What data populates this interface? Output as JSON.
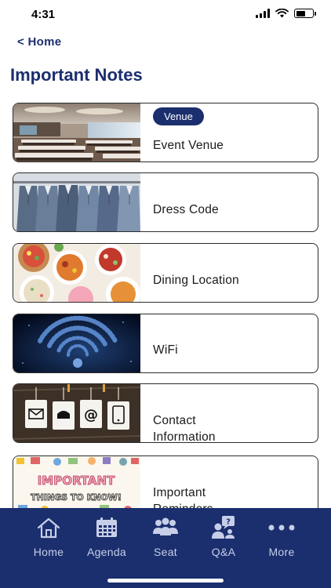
{
  "status": {
    "time": "4:31",
    "signal_icon": "cellular-signal-icon",
    "wifi_icon": "wifi-icon",
    "battery_icon": "battery-icon"
  },
  "nav": {
    "back_label": "< Home"
  },
  "page": {
    "title": "Important Notes"
  },
  "cards": [
    {
      "label": "Event Venue",
      "badge": "Venue",
      "thumb": "conference-hall-image"
    },
    {
      "label": "Dress Code",
      "thumb": "suits-rack-image"
    },
    {
      "label": "Dining Location",
      "thumb": "food-bowls-image"
    },
    {
      "label": "WiFi",
      "thumb": "wifi-glow-image"
    },
    {
      "label_line1": "Contact",
      "label_line2": "Information",
      "thumb": "contact-tags-image"
    },
    {
      "label_line1": "Important",
      "label_line2": "Reminders",
      "thumb": "things-to-know-image"
    }
  ],
  "tabbar": {
    "items": [
      {
        "label": "Home",
        "icon": "home-icon"
      },
      {
        "label": "Agenda",
        "icon": "calendar-icon"
      },
      {
        "label": "Seat",
        "icon": "people-icon"
      },
      {
        "label": "Q&A",
        "icon": "question-person-icon"
      },
      {
        "label": "More",
        "icon": "more-dots-icon"
      }
    ]
  },
  "colors": {
    "brand": "#1b2e6e",
    "tab_inactive": "#c7cfe8",
    "card_border": "#2b2b2b"
  }
}
